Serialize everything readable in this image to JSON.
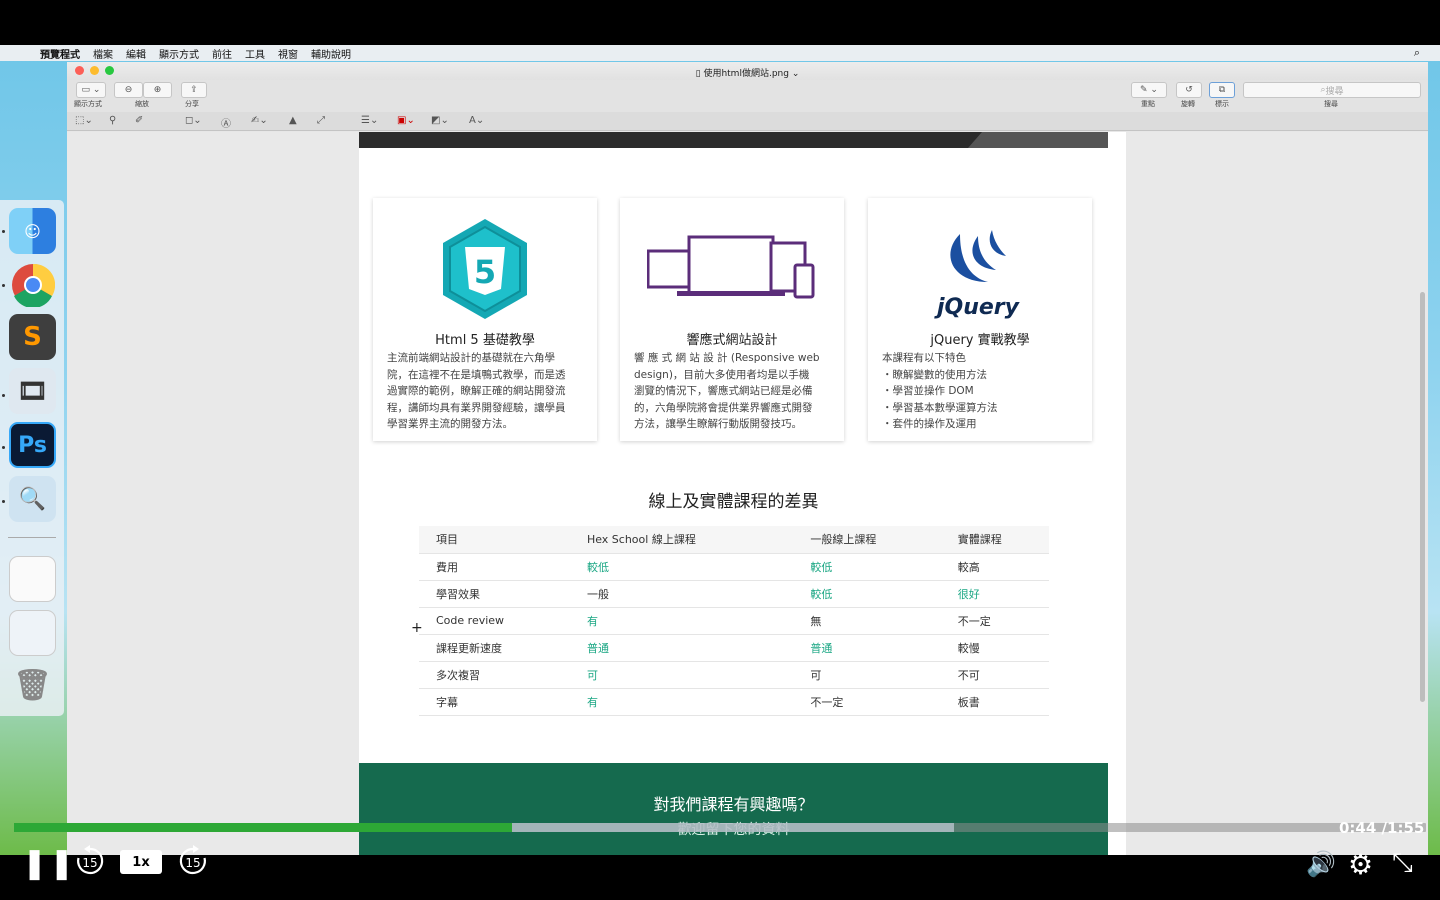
{
  "menubar": {
    "app_name": "預覽程式",
    "items": [
      "檔案",
      "編輯",
      "顯示方式",
      "前往",
      "工具",
      "視窗",
      "輔助說明"
    ]
  },
  "window": {
    "title": "使用html做網站.png",
    "toolbar": {
      "view_label": "顯示方式",
      "zoom_label": "縮放",
      "share_label": "分享",
      "highlight_label": "重點",
      "rotate_label": "旋轉",
      "markup_label": "標示",
      "search_label": "搜尋",
      "search_placeholder": "搜尋"
    }
  },
  "page": {
    "cards": [
      {
        "title": "Html 5 基礎教學",
        "body": "主流前端網站設計的基礎就在六角學\n院，在這裡不在是填鴨式教學，而是透\n過實際的範例，瞭解正確的網站開發流\n程，講師均具有業界開發經驗，讓學員\n學習業界主流的開發方法。",
        "icon": "html5-icon",
        "html5_digit": "5"
      },
      {
        "title": "響應式網站設計",
        "body": "響 應 式 網 站 設 計 (Responsive web\ndesign)，目前大多使用者均是以手機\n瀏覽的情況下，響應式網站已經是必備\n的，六角學院將會提供業界響應式開發\n方法，讓學生瞭解行動版開發技巧。",
        "icon": "devices-icon"
      },
      {
        "title": "jQuery 實戰教學",
        "body": "本課程有以下特色\n・瞭解變數的使用方法\n・學習並操作 DOM\n・學習基本數學運算方法\n・套件的操作及運用",
        "icon": "jquery-icon",
        "logo_text": "jQuery"
      }
    ],
    "section_title": "線上及實體課程的差異",
    "table": {
      "headers": [
        "項目",
        "Hex School 線上課程",
        "一般線上課程",
        "實體課程"
      ],
      "rows": [
        [
          "費用",
          "較低",
          "較低",
          "較高"
        ],
        [
          "學習效果",
          "一般",
          "較低",
          "很好"
        ],
        [
          "Code review",
          "有",
          "無",
          "不一定"
        ],
        [
          "課程更新速度",
          "普通",
          "普通",
          "較慢"
        ],
        [
          "多次複習",
          "可",
          "可",
          "不可"
        ],
        [
          "字幕",
          "有",
          "不一定",
          "板書"
        ]
      ],
      "highlight_color": "#1ba784"
    },
    "cta": {
      "question": "對我們課程有興趣嗎？",
      "subtitle": "歡迎留下您的資料",
      "background": "#156a4e"
    }
  },
  "dock": {
    "apps": [
      "finder-icon",
      "chrome-icon",
      "sublime-text-icon",
      "photo-slideshow-icon",
      "photoshop-icon",
      "preview-icon",
      "document-thumbnail-icon",
      "window-thumbnail-icon",
      "trash-icon"
    ],
    "photoshop_label": "Ps",
    "sublime_label": "S"
  },
  "player": {
    "current_time": "0:44",
    "total_time": "/1:55",
    "progress_fraction": 0.353,
    "buffered_fraction": 0.666,
    "speed": "1x",
    "skip_back_label": "15",
    "skip_forward_label": "15",
    "progress_color": "#2da836"
  }
}
